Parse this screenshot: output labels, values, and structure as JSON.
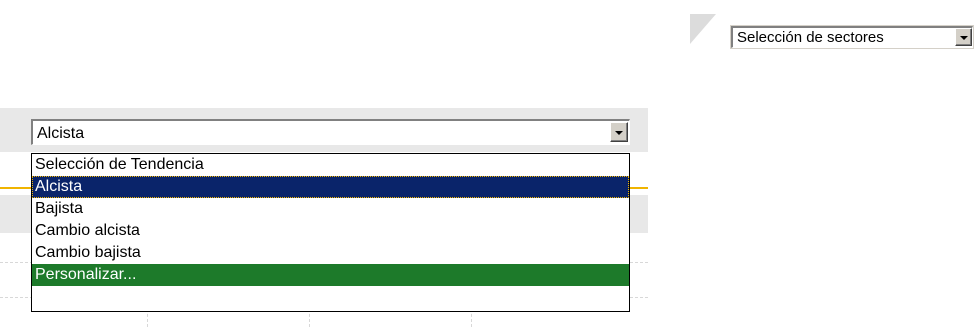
{
  "sector_selector": {
    "value": "Selección de sectores",
    "arrow_icon": "chevron-down-icon"
  },
  "trend_selector": {
    "value": "Alcista",
    "arrow_icon": "chevron-down-icon",
    "options": [
      "Selección de Tendencia",
      "Alcista",
      "Bajista",
      "Cambio alcista",
      "Cambio bajista",
      "Personalizar..."
    ],
    "selected_option": "Alcista"
  },
  "colors": {
    "highlight_selected": "#0a246a",
    "highlight_custom": "#1d7a2a",
    "accent_line": "#f0b400"
  }
}
